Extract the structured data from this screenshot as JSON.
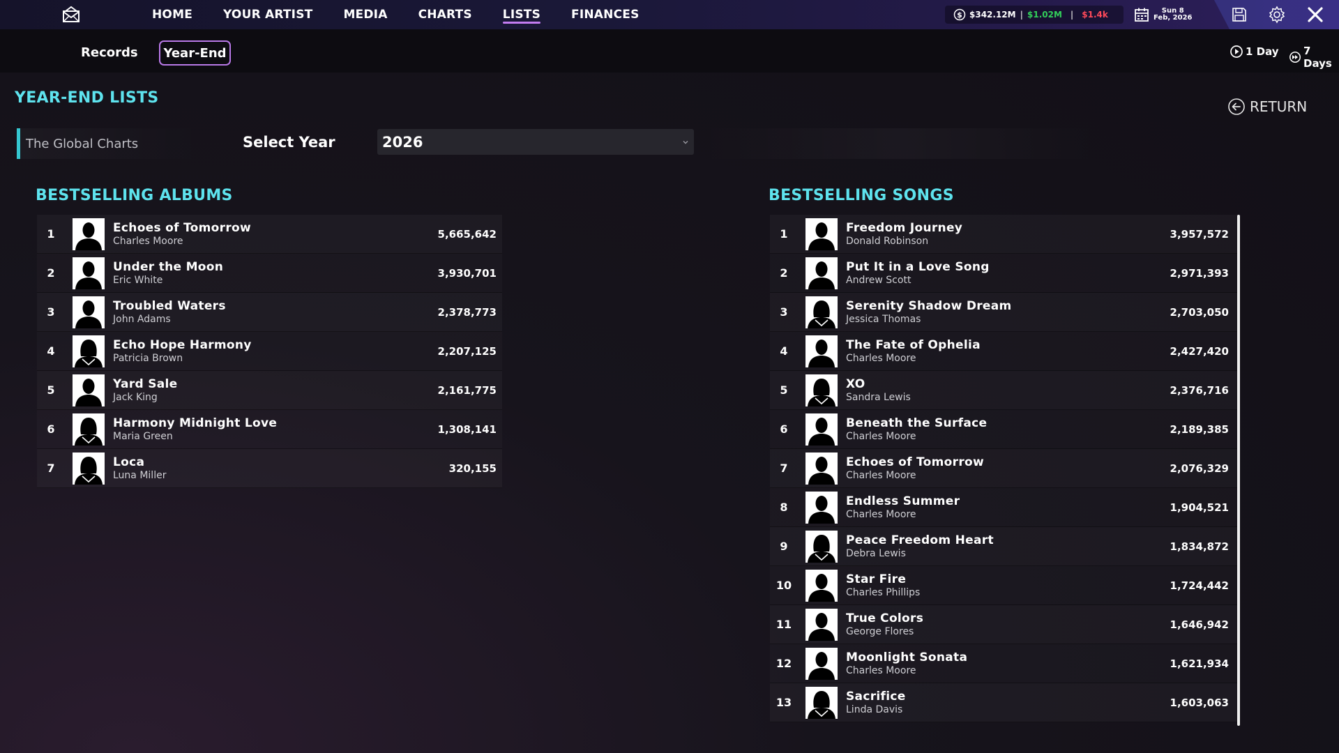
{
  "nav": {
    "items": [
      {
        "label": "HOME",
        "active": false
      },
      {
        "label": "YOUR ARTIST",
        "active": false
      },
      {
        "label": "MEDIA",
        "active": false
      },
      {
        "label": "CHARTS",
        "active": false
      },
      {
        "label": "LISTS",
        "active": true
      },
      {
        "label": "FINANCES",
        "active": false
      }
    ]
  },
  "status": {
    "balance": "$342.12M",
    "income": "$1.02M",
    "expense": "$1.4k",
    "date_line1": "Sun 8",
    "date_line2": "Feb, 2026",
    "colors": {
      "income": "#32d05a",
      "expense": "#ff4a5a",
      "accent": "#b979e8",
      "heading": "#5ee3ee"
    }
  },
  "subnav": {
    "records": "Records",
    "year_end": "Year-End",
    "advance_1": "1 Day",
    "advance_7": "7 Days"
  },
  "header": {
    "title": "YEAR-END LISTS",
    "return": "RETURN",
    "chart_name": "The Global Charts",
    "select_year_label": "Select Year",
    "selected_year": "2026"
  },
  "albums": {
    "title": "BESTSELLING ALBUMS",
    "rows": [
      {
        "rank": "1",
        "title": "Echoes of Tomorrow",
        "artist": "Charles Moore",
        "sales": "5,665,642",
        "avatar": "male"
      },
      {
        "rank": "2",
        "title": "Under the Moon",
        "artist": "Eric White",
        "sales": "3,930,701",
        "avatar": "male"
      },
      {
        "rank": "3",
        "title": "Troubled Waters",
        "artist": "John Adams",
        "sales": "2,378,773",
        "avatar": "male"
      },
      {
        "rank": "4",
        "title": "Echo Hope Harmony",
        "artist": "Patricia Brown",
        "sales": "2,207,125",
        "avatar": "female"
      },
      {
        "rank": "5",
        "title": "Yard Sale",
        "artist": "Jack King",
        "sales": "2,161,775",
        "avatar": "male"
      },
      {
        "rank": "6",
        "title": "Harmony Midnight Love",
        "artist": "Maria Green",
        "sales": "1,308,141",
        "avatar": "female"
      },
      {
        "rank": "7",
        "title": "Loca",
        "artist": "Luna Miller",
        "sales": "320,155",
        "avatar": "female"
      }
    ]
  },
  "songs": {
    "title": "BESTSELLING SONGS",
    "rows": [
      {
        "rank": "1",
        "title": "Freedom Journey",
        "artist": "Donald Robinson",
        "sales": "3,957,572",
        "avatar": "male"
      },
      {
        "rank": "2",
        "title": "Put It in a Love Song",
        "artist": "Andrew Scott",
        "sales": "2,971,393",
        "avatar": "male"
      },
      {
        "rank": "3",
        "title": "Serenity Shadow Dream",
        "artist": "Jessica Thomas",
        "sales": "2,703,050",
        "avatar": "female"
      },
      {
        "rank": "4",
        "title": "The Fate of Ophelia",
        "artist": "Charles Moore",
        "sales": "2,427,420",
        "avatar": "male"
      },
      {
        "rank": "5",
        "title": "XO",
        "artist": "Sandra Lewis",
        "sales": "2,376,716",
        "avatar": "female"
      },
      {
        "rank": "6",
        "title": "Beneath the Surface",
        "artist": "Charles Moore",
        "sales": "2,189,385",
        "avatar": "male"
      },
      {
        "rank": "7",
        "title": "Echoes of Tomorrow",
        "artist": "Charles Moore",
        "sales": "2,076,329",
        "avatar": "male"
      },
      {
        "rank": "8",
        "title": "Endless Summer",
        "artist": "Charles Moore",
        "sales": "1,904,521",
        "avatar": "male"
      },
      {
        "rank": "9",
        "title": "Peace Freedom Heart",
        "artist": "Debra Lewis",
        "sales": "1,834,872",
        "avatar": "female"
      },
      {
        "rank": "10",
        "title": "Star Fire",
        "artist": "Charles Phillips",
        "sales": "1,724,442",
        "avatar": "male"
      },
      {
        "rank": "11",
        "title": "True Colors",
        "artist": "George Flores",
        "sales": "1,646,942",
        "avatar": "male"
      },
      {
        "rank": "12",
        "title": "Moonlight Sonata",
        "artist": "Charles Moore",
        "sales": "1,621,934",
        "avatar": "male"
      },
      {
        "rank": "13",
        "title": "Sacrifice",
        "artist": "Linda Davis",
        "sales": "1,603,063",
        "avatar": "female"
      }
    ]
  }
}
